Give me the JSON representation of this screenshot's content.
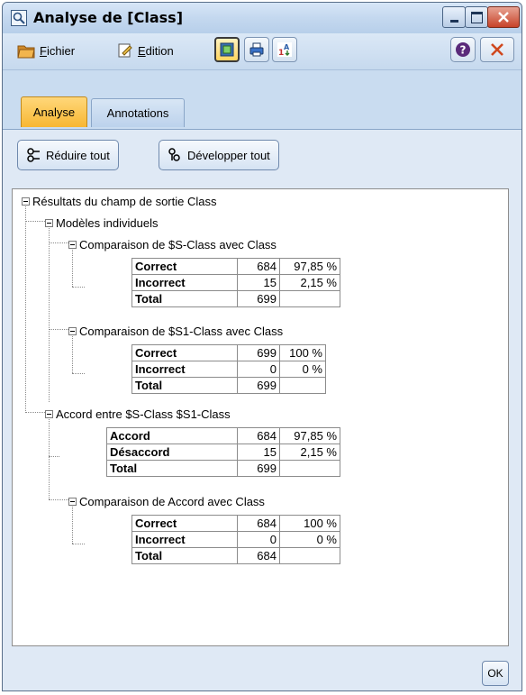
{
  "window": {
    "title": "Analyse de [Class]",
    "icons": {
      "title": "analysis-icon",
      "minimize": "minimize-icon",
      "maximize": "maximize-icon",
      "close": "close-icon"
    }
  },
  "menu": {
    "file": "Fichier",
    "edit": "Edition",
    "tools": [
      "generate-icon",
      "print-icon",
      "export-icon"
    ],
    "help_icon": "help-icon",
    "close_icon": "close-icon"
  },
  "tabs": [
    {
      "label": "Analyse",
      "active": true
    },
    {
      "label": "Annotations",
      "active": false
    }
  ],
  "commands": {
    "collapse": "Réduire tout",
    "expand": "Développer tout"
  },
  "tree": {
    "root": "Résultats du champ de sortie Class",
    "individual": "Modèles individuels",
    "comp1": {
      "title": "Comparaison de $S-Class avec Class",
      "rows": [
        {
          "label": "Correct",
          "count": "684",
          "pct": "97,85 %"
        },
        {
          "label": "Incorrect",
          "count": "15",
          "pct": "2,15 %"
        },
        {
          "label": "Total",
          "count": "699",
          "pct": ""
        }
      ]
    },
    "comp2": {
      "title": "Comparaison de $S1-Class avec Class",
      "rows": [
        {
          "label": "Correct",
          "count": "699",
          "pct": "100 %"
        },
        {
          "label": "Incorrect",
          "count": "0",
          "pct": "0 %"
        },
        {
          "label": "Total",
          "count": "699",
          "pct": ""
        }
      ]
    },
    "agreement": {
      "title": "Accord entre  $S-Class $S1-Class",
      "rows": [
        {
          "label": "Accord",
          "count": "684",
          "pct": "97,85 %"
        },
        {
          "label": "Désaccord",
          "count": "15",
          "pct": "2,15 %"
        },
        {
          "label": "Total",
          "count": "699",
          "pct": ""
        }
      ]
    },
    "comp3": {
      "title": "Comparaison de Accord avec Class",
      "rows": [
        {
          "label": "Correct",
          "count": "684",
          "pct": "100 %"
        },
        {
          "label": "Incorrect",
          "count": "0",
          "pct": "0 %"
        },
        {
          "label": "Total",
          "count": "684",
          "pct": ""
        }
      ]
    }
  },
  "ok": "OK",
  "colors": {
    "accent_tab": "#f7b733",
    "frame": "#c9dcf0"
  }
}
